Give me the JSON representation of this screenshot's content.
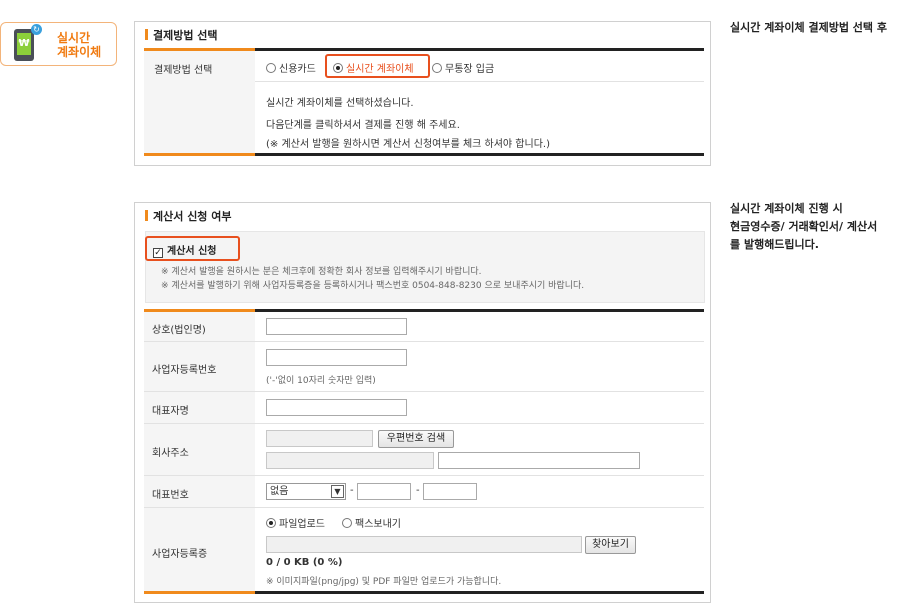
{
  "badge": {
    "currency_symbol": "₩",
    "line1": "실시간",
    "line2": "계좌이체"
  },
  "notes": {
    "note1": "실시간 계좌이체 결제방법 선택 후",
    "note2_lines": [
      "실시간 계좌이체 진행 시",
      "현금영수증/ 거래확인서/ 계산서",
      "를 발행해드립니다."
    ]
  },
  "payment": {
    "title": "결제방법 선택",
    "row_label": "결제방법 선택",
    "options": [
      {
        "label": "신용카드",
        "selected": false
      },
      {
        "label": "실시간 계좌이체",
        "selected": true
      },
      {
        "label": "무통장 입금",
        "selected": false
      }
    ],
    "messages": [
      "실시간 계좌이체를 선택하셨습니다.",
      "다음단계를 클릭하셔서 결제를 진행 해 주세요.",
      "(※ 계산서 발행을 원하시면 계산서 신청여부를 체크 하셔야 합니다.)"
    ]
  },
  "invoice": {
    "title": "계산서 신청 여부",
    "checkbox_label": "계산서 신청",
    "checked": true,
    "notices": [
      "※ 계산서 발행을 원하시는 분은 체크후에 정확한 회사 정보를 입력해주시기 바랍니다.",
      "※ 계산서를 발행하기 위해 사업자등록증을 등록하시거나 팩스번호 0504-848-8230 으로 보내주시기 바랍니다."
    ],
    "fields": {
      "company_name": {
        "label": "상호(법인명)",
        "value": ""
      },
      "biz_number": {
        "label": "사업자등록번호",
        "value": "",
        "hint": "('-'없이 10자리 숫자만 입력)"
      },
      "ceo_name": {
        "label": "대표자명",
        "value": ""
      },
      "address": {
        "label": "회사주소",
        "zip_button": "우편번호 검색",
        "value1": "",
        "value2": "",
        "value3": ""
      },
      "phone": {
        "label": "대표번호",
        "selected": "없음",
        "part2": "",
        "part3": "",
        "separator": "-"
      },
      "registration": {
        "label": "사업자등록증",
        "options": [
          {
            "label": "파일업로드",
            "selected": true
          },
          {
            "label": "팩스보내기",
            "selected": false
          }
        ],
        "browse_button": "찾아보기",
        "file_size": "0 / 0 KB (0 %)",
        "file_hint": "※ 이미지파일(png/jpg) 및 PDF 파일만 업로드가 가능합니다."
      }
    }
  }
}
